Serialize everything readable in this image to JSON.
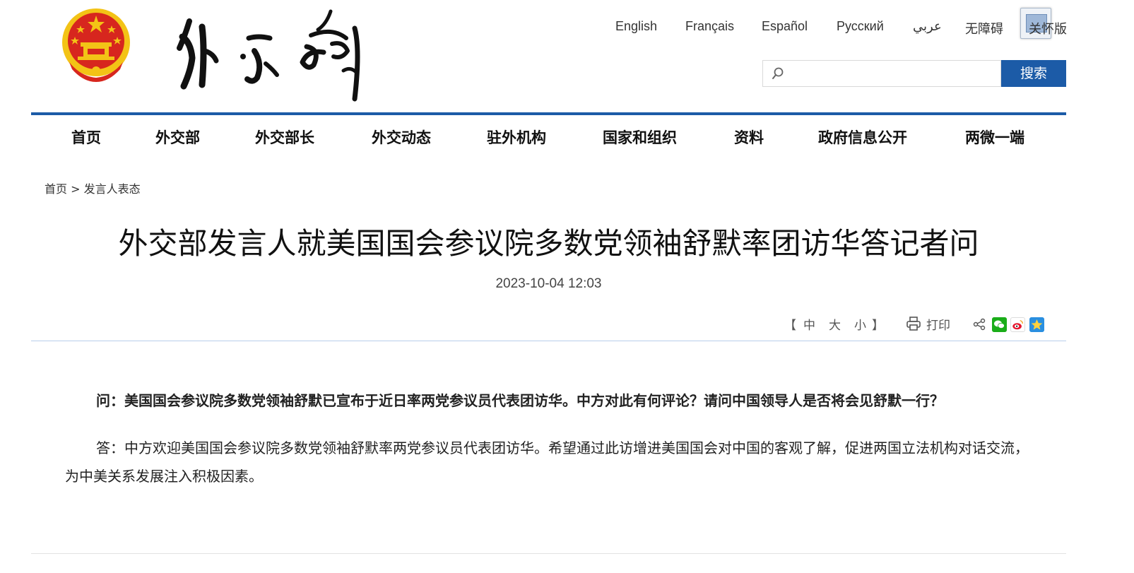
{
  "header": {
    "logo_text": "外交部",
    "languages": [
      "English",
      "Français",
      "Español",
      "Русский",
      "عربي",
      "无障碍",
      "关怀版"
    ],
    "search": {
      "placeholder": "",
      "button_label": "搜索"
    }
  },
  "nav": {
    "items": [
      "首页",
      "外交部",
      "外交部长",
      "外交动态",
      "驻外机构",
      "国家和组织",
      "资料",
      "政府信息公开",
      "两微一端"
    ]
  },
  "breadcrumb": {
    "home": "首页",
    "separator": ">",
    "current": "发言人表态"
  },
  "article": {
    "title": "外交部发言人就美国国会参议院多数党领袖舒默率团访华答记者问",
    "date": "2023-10-04 12:03",
    "tools": {
      "bracket_open": "【",
      "font_sizes": [
        "中",
        "大",
        "小"
      ],
      "bracket_close": "】",
      "print_label": "打印"
    },
    "question": "问：美国国会参议院多数党领袖舒默已宣布于近日率两党参议员代表团访华。中方对此有何评论？请问中国领导人是否将会见舒默一行？",
    "answer": "答：中方欢迎美国国会参议院多数党领袖舒默率两党参议员代表团访华。希望通过此访增进美国国会对中国的客观了解，促进两国立法机构对话交流，为中美关系发展注入积极因素。"
  },
  "colors": {
    "primary_blue": "#1c5ba7",
    "emblem_red": "#d7261e",
    "emblem_gold": "#f3c316"
  },
  "icons": [
    "national-emblem-icon",
    "search-icon",
    "care-mode-icon",
    "print-icon",
    "share-icon",
    "wechat-icon",
    "weibo-icon",
    "qzone-icon"
  ]
}
